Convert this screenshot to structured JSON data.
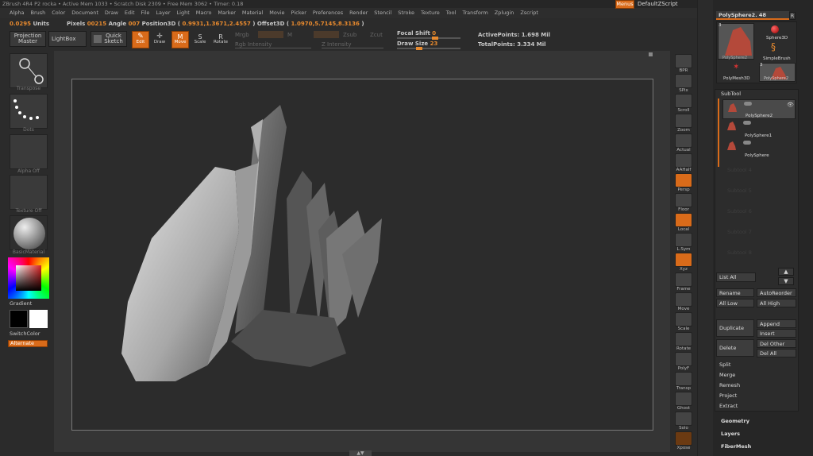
{
  "titlebar": {
    "text": "ZBrush 4R4 P2     rocka    • Active Mem 1033  • Scratch Disk 2309  • Free Mem 3062  • Timer: 0.18"
  },
  "menu": [
    "Alpha",
    "Brush",
    "Color",
    "Document",
    "Draw",
    "Edit",
    "File",
    "Layer",
    "Light",
    "Macro",
    "Marker",
    "Material",
    "Movie",
    "Picker",
    "Preferences",
    "Render",
    "Stencil",
    "Stroke",
    "Texture",
    "Tool",
    "Transform",
    "Zplugin",
    "Zscript"
  ],
  "menus_button": "Menus",
  "default_script": "DefaultZScript",
  "info": {
    "units_val": "0.0295",
    "units": "Units",
    "pixels_label": "Pixels",
    "pixels_val": "00215",
    "angle_label": "Angle",
    "angle_val": "007",
    "position_label": "Position3D (",
    "position_val": "0.9931,1.3671,2.4557",
    "offset_label": ") Offset3D (",
    "offset_val": "1.0970,5.7145,8.3136",
    "close": ")"
  },
  "toolbar": {
    "projection_master": "Projection Master",
    "lightbox": "LightBox",
    "quick_sketch": "Quick Sketch",
    "edit": "Edit",
    "draw": "Draw",
    "move": "Move",
    "scale": "Scale",
    "rotate": "Rotate",
    "mrgb": "Mrgb",
    "rgb": "Rgb",
    "m": "M",
    "zadd": "Zadd",
    "zsub": "Zsub",
    "zcut": "Zcut",
    "rgb_intensity": "Rgb Intensity",
    "z_intensity": "Z Intensity",
    "focal_shift_label": "Focal Shift",
    "focal_shift_val": "0",
    "draw_size_label": "Draw Size",
    "draw_size_val": "23",
    "active_points_label": "ActivePoints:",
    "active_points_val": "1.698 Mil",
    "total_points_label": "TotalPoints:",
    "total_points_val": "3.334 Mil"
  },
  "left": {
    "transpose": "Transpose",
    "dots": "Dots",
    "alpha_off": "Alpha Off",
    "texture_off": "Texture Off",
    "basic_material": "BasicMaterial",
    "gradient": "Gradient",
    "switch_color": "SwitchColor",
    "alternate": "Alternate"
  },
  "right_strip": [
    "BPR",
    "SPix",
    "Scroll",
    "Zoom",
    "Actual",
    "AAHalf",
    "Persp",
    "Floor",
    "Local",
    "L.Sym",
    "Xyz",
    "Frame",
    "Move",
    "Scale",
    "Rotate",
    "PolyF",
    "Transp",
    "Ghost",
    "Solo",
    "Xpose"
  ],
  "panel": {
    "tool_name": "PolySphere2. 48",
    "r": "R",
    "tools": [
      "PolySphere2",
      "Sphere3D",
      "SimpleBrush",
      "PolyMesh3D",
      "PolySphere2"
    ],
    "tool_count_a": "3",
    "tool_count_b": "3",
    "subtool_header": "SubTool",
    "subtools": [
      "PolySphere2",
      "PolySphere1",
      "PolySphere"
    ],
    "empty_slots": [
      "Subtool 4",
      "Subtool 5",
      "Subtool 6",
      "Subtool 7",
      "Subtool 8"
    ],
    "list_all": "List All",
    "rename": "Rename",
    "auto_reorder": "AutoReorder",
    "all_low": "All Low",
    "all_high": "All High",
    "duplicate": "Duplicate",
    "append": "Append",
    "insert": "Insert",
    "delete": "Delete",
    "del_other": "Del Other",
    "del_all": "Del All",
    "split": "Split",
    "merge": "Merge",
    "remesh": "Remesh",
    "project": "Project",
    "extract": "Extract",
    "geometry": "Geometry",
    "layers": "Layers",
    "fibermesh": "FiberMesh"
  },
  "colors": {
    "accent": "#d96b1a",
    "bg": "#2b2b2b"
  }
}
